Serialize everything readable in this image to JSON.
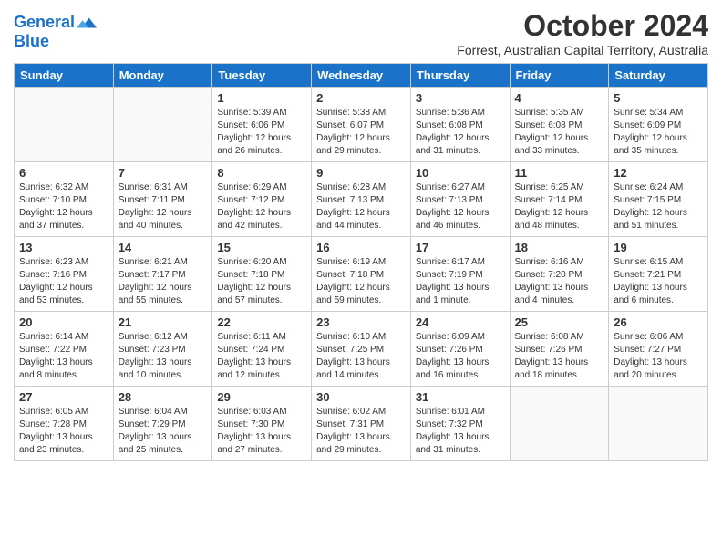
{
  "logo": {
    "line1": "General",
    "line2": "Blue"
  },
  "title": "October 2024",
  "subtitle": "Forrest, Australian Capital Territory, Australia",
  "headers": [
    "Sunday",
    "Monday",
    "Tuesday",
    "Wednesday",
    "Thursday",
    "Friday",
    "Saturday"
  ],
  "weeks": [
    [
      {
        "day": "",
        "info": ""
      },
      {
        "day": "",
        "info": ""
      },
      {
        "day": "1",
        "info": "Sunrise: 5:39 AM\nSunset: 6:06 PM\nDaylight: 12 hours\nand 26 minutes."
      },
      {
        "day": "2",
        "info": "Sunrise: 5:38 AM\nSunset: 6:07 PM\nDaylight: 12 hours\nand 29 minutes."
      },
      {
        "day": "3",
        "info": "Sunrise: 5:36 AM\nSunset: 6:08 PM\nDaylight: 12 hours\nand 31 minutes."
      },
      {
        "day": "4",
        "info": "Sunrise: 5:35 AM\nSunset: 6:08 PM\nDaylight: 12 hours\nand 33 minutes."
      },
      {
        "day": "5",
        "info": "Sunrise: 5:34 AM\nSunset: 6:09 PM\nDaylight: 12 hours\nand 35 minutes."
      }
    ],
    [
      {
        "day": "6",
        "info": "Sunrise: 6:32 AM\nSunset: 7:10 PM\nDaylight: 12 hours\nand 37 minutes."
      },
      {
        "day": "7",
        "info": "Sunrise: 6:31 AM\nSunset: 7:11 PM\nDaylight: 12 hours\nand 40 minutes."
      },
      {
        "day": "8",
        "info": "Sunrise: 6:29 AM\nSunset: 7:12 PM\nDaylight: 12 hours\nand 42 minutes."
      },
      {
        "day": "9",
        "info": "Sunrise: 6:28 AM\nSunset: 7:13 PM\nDaylight: 12 hours\nand 44 minutes."
      },
      {
        "day": "10",
        "info": "Sunrise: 6:27 AM\nSunset: 7:13 PM\nDaylight: 12 hours\nand 46 minutes."
      },
      {
        "day": "11",
        "info": "Sunrise: 6:25 AM\nSunset: 7:14 PM\nDaylight: 12 hours\nand 48 minutes."
      },
      {
        "day": "12",
        "info": "Sunrise: 6:24 AM\nSunset: 7:15 PM\nDaylight: 12 hours\nand 51 minutes."
      }
    ],
    [
      {
        "day": "13",
        "info": "Sunrise: 6:23 AM\nSunset: 7:16 PM\nDaylight: 12 hours\nand 53 minutes."
      },
      {
        "day": "14",
        "info": "Sunrise: 6:21 AM\nSunset: 7:17 PM\nDaylight: 12 hours\nand 55 minutes."
      },
      {
        "day": "15",
        "info": "Sunrise: 6:20 AM\nSunset: 7:18 PM\nDaylight: 12 hours\nand 57 minutes."
      },
      {
        "day": "16",
        "info": "Sunrise: 6:19 AM\nSunset: 7:18 PM\nDaylight: 12 hours\nand 59 minutes."
      },
      {
        "day": "17",
        "info": "Sunrise: 6:17 AM\nSunset: 7:19 PM\nDaylight: 13 hours\nand 1 minute."
      },
      {
        "day": "18",
        "info": "Sunrise: 6:16 AM\nSunset: 7:20 PM\nDaylight: 13 hours\nand 4 minutes."
      },
      {
        "day": "19",
        "info": "Sunrise: 6:15 AM\nSunset: 7:21 PM\nDaylight: 13 hours\nand 6 minutes."
      }
    ],
    [
      {
        "day": "20",
        "info": "Sunrise: 6:14 AM\nSunset: 7:22 PM\nDaylight: 13 hours\nand 8 minutes."
      },
      {
        "day": "21",
        "info": "Sunrise: 6:12 AM\nSunset: 7:23 PM\nDaylight: 13 hours\nand 10 minutes."
      },
      {
        "day": "22",
        "info": "Sunrise: 6:11 AM\nSunset: 7:24 PM\nDaylight: 13 hours\nand 12 minutes."
      },
      {
        "day": "23",
        "info": "Sunrise: 6:10 AM\nSunset: 7:25 PM\nDaylight: 13 hours\nand 14 minutes."
      },
      {
        "day": "24",
        "info": "Sunrise: 6:09 AM\nSunset: 7:26 PM\nDaylight: 13 hours\nand 16 minutes."
      },
      {
        "day": "25",
        "info": "Sunrise: 6:08 AM\nSunset: 7:26 PM\nDaylight: 13 hours\nand 18 minutes."
      },
      {
        "day": "26",
        "info": "Sunrise: 6:06 AM\nSunset: 7:27 PM\nDaylight: 13 hours\nand 20 minutes."
      }
    ],
    [
      {
        "day": "27",
        "info": "Sunrise: 6:05 AM\nSunset: 7:28 PM\nDaylight: 13 hours\nand 23 minutes."
      },
      {
        "day": "28",
        "info": "Sunrise: 6:04 AM\nSunset: 7:29 PM\nDaylight: 13 hours\nand 25 minutes."
      },
      {
        "day": "29",
        "info": "Sunrise: 6:03 AM\nSunset: 7:30 PM\nDaylight: 13 hours\nand 27 minutes."
      },
      {
        "day": "30",
        "info": "Sunrise: 6:02 AM\nSunset: 7:31 PM\nDaylight: 13 hours\nand 29 minutes."
      },
      {
        "day": "31",
        "info": "Sunrise: 6:01 AM\nSunset: 7:32 PM\nDaylight: 13 hours\nand 31 minutes."
      },
      {
        "day": "",
        "info": ""
      },
      {
        "day": "",
        "info": ""
      }
    ]
  ]
}
